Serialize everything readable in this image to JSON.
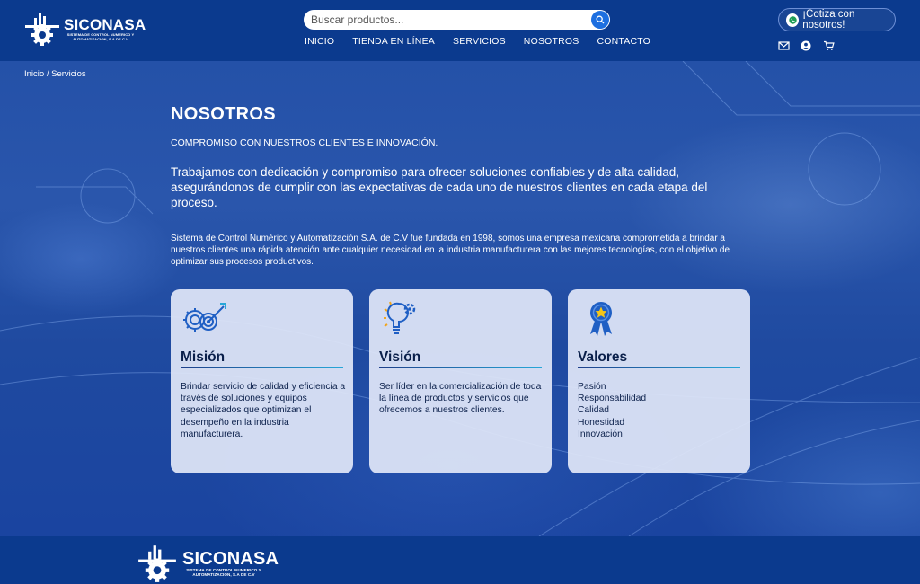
{
  "brand": {
    "name": "SICONASA",
    "tagline": "SISTEMA DE CONTROL NUMERICO Y AUTOMATIZACION, S.A DE C.V"
  },
  "search": {
    "placeholder": "Buscar productos..."
  },
  "nav": [
    "INICIO",
    "TIENDA EN LÍNEA",
    "SERVICIOS",
    "NOSOTROS",
    "CONTACTO"
  ],
  "header": {
    "quote_label": "¡Cotiza con nosotros!"
  },
  "header_icons": [
    "mail-icon",
    "user-icon",
    "cart-icon"
  ],
  "breadcrumb": {
    "home": "Inicio",
    "separator": " / ",
    "current": "Servicios"
  },
  "page": {
    "title": "NOSOTROS",
    "subtitle": "COMPROMISO CON NUESTROS CLIENTES E INNOVACIÓN.",
    "lead": "Trabajamos con dedicación y compromiso para ofrecer soluciones confiables y de alta calidad, asegurándonos de cumplir con las expectativas de cada uno de nuestros clientes en cada etapa del proceso.",
    "paragraph": "Sistema de Control Numérico y Automatización S.A. de C.V fue fundada en 1998, somos una empresa mexicana comprometida a brindar a nuestros clientes una rápida atención ante cualquier necesidad en la industria manufacturera con las mejores tecnologías, con el objetivo de optimizar sus procesos productivos."
  },
  "cards": {
    "mision": {
      "title": "Misión",
      "icon": "target-gear-icon",
      "text": "Brindar servicio de calidad y eficiencia a través de soluciones y equipos especializados que optimizan el desempeño en la industria manufacturera."
    },
    "vision": {
      "title": "Visión",
      "icon": "lightbulb-gear-icon",
      "text": "Ser líder en la comercialización de toda la línea de productos y servicios que ofrecemos a nuestros clientes."
    },
    "valores": {
      "title": "Valores",
      "icon": "award-ribbon-icon",
      "items": [
        "Pasión",
        "Responsabilidad",
        "Calidad",
        "Honestidad",
        "Innovación"
      ]
    }
  },
  "colors": {
    "header_bg": "#0b3a8e",
    "accent": "#1d6fe0",
    "card_bg": "#e0e6f8",
    "card_text": "#0a1f4a"
  }
}
